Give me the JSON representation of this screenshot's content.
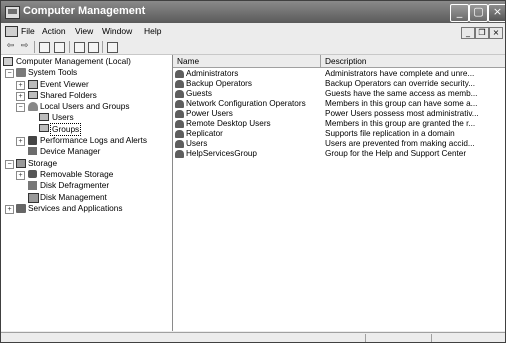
{
  "window": {
    "title": "Computer Management"
  },
  "menubar": {
    "items": [
      "File",
      "Action",
      "View",
      "Window",
      "Help"
    ]
  },
  "title_buttons": {
    "minimize": "_",
    "maximize": "▢",
    "close": "×"
  },
  "mdi_buttons": {
    "minimize": "_",
    "restore": "❐",
    "close": "×"
  },
  "toolbar": {
    "icons": [
      "back-arrow-icon",
      "forward-arrow-icon",
      "up-folder-icon",
      "show-hide-tree-icon",
      "properties-icon",
      "export-list-icon",
      "help-icon"
    ]
  },
  "tree": {
    "root": "Computer Management (Local)",
    "system_tools": "System Tools",
    "event_viewer": "Event Viewer",
    "shared_folders": "Shared Folders",
    "local_users_groups": "Local Users and Groups",
    "users": "Users",
    "groups": "Groups",
    "performance_logs": "Performance Logs and Alerts",
    "device_manager": "Device Manager",
    "storage": "Storage",
    "removable_storage": "Removable Storage",
    "disk_defragmenter": "Disk Defragmenter",
    "disk_management": "Disk Management",
    "services_apps": "Services and Applications",
    "expand_plus": "+",
    "collapse_minus": "−"
  },
  "list": {
    "columns": [
      "Name",
      "Description"
    ],
    "rows": [
      {
        "name": "Administrators",
        "description": "Administrators have complete and unre..."
      },
      {
        "name": "Backup Operators",
        "description": "Backup Operators can override security..."
      },
      {
        "name": "Guests",
        "description": "Guests have the same access as memb..."
      },
      {
        "name": "Network Configuration Operators",
        "description": "Members in this group can have some a..."
      },
      {
        "name": "Power Users",
        "description": "Power Users possess most administrativ..."
      },
      {
        "name": "Remote Desktop Users",
        "description": "Members in this group are granted the r..."
      },
      {
        "name": "Replicator",
        "description": "Supports file replication in a domain"
      },
      {
        "name": "Users",
        "description": "Users are prevented from making accid..."
      },
      {
        "name": "HelpServicesGroup",
        "description": "Group for the Help and Support Center"
      }
    ]
  }
}
